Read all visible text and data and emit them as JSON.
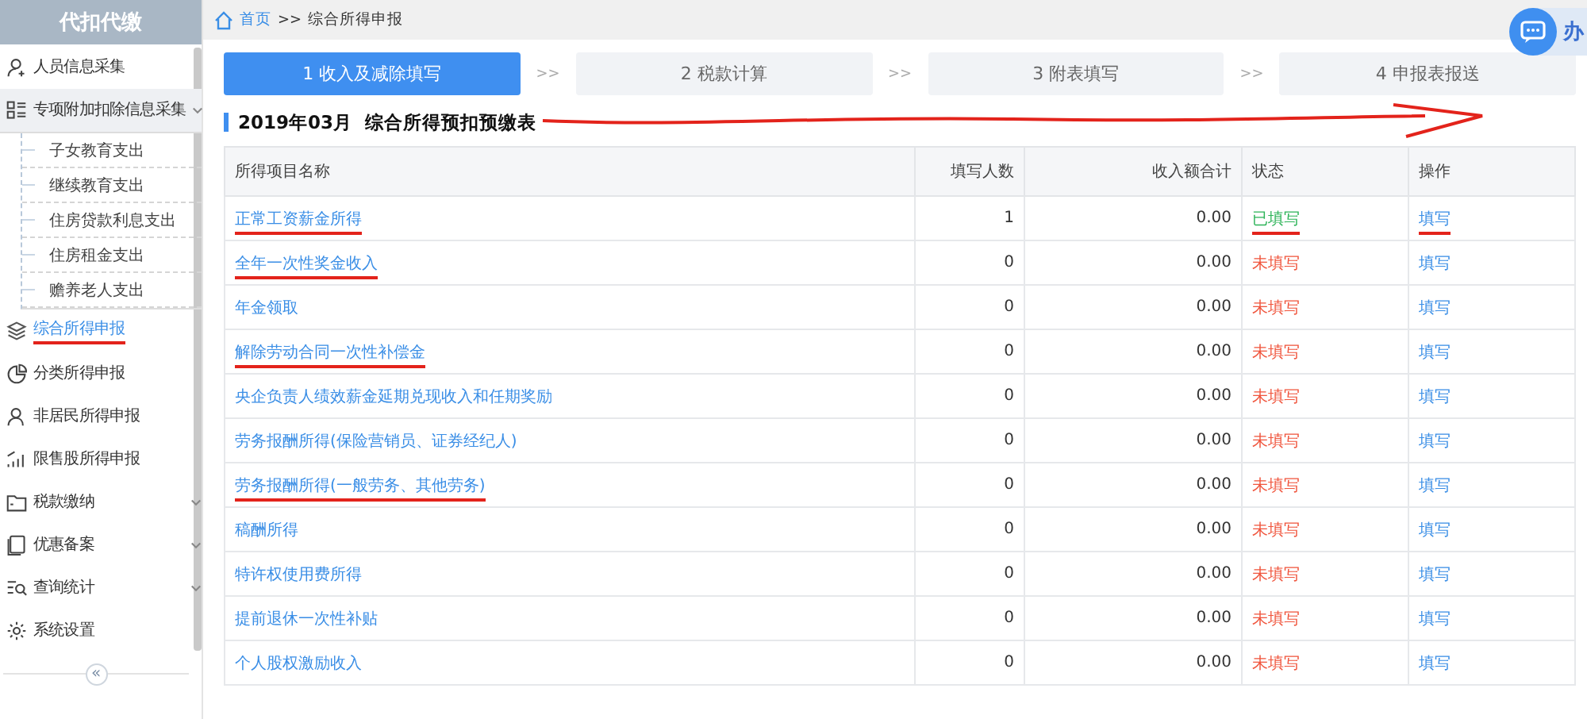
{
  "sidebar": {
    "title": "代扣代缴",
    "items": [
      {
        "label": "人员信息采集",
        "selected": false,
        "marked": false
      },
      {
        "label": "专项附加扣除信息采集",
        "selected": false,
        "marked": false,
        "expanded": true,
        "children": [
          {
            "label": "子女教育支出"
          },
          {
            "label": "继续教育支出"
          },
          {
            "label": "住房贷款利息支出"
          },
          {
            "label": "住房租金支出"
          },
          {
            "label": "赡养老人支出"
          }
        ]
      },
      {
        "label": "综合所得申报",
        "selected": true,
        "marked": true
      },
      {
        "label": "分类所得申报",
        "selected": false,
        "marked": false
      },
      {
        "label": "非居民所得申报",
        "selected": false,
        "marked": false
      },
      {
        "label": "限售股所得申报",
        "selected": false,
        "marked": false
      },
      {
        "label": "税款缴纳",
        "selected": false,
        "marked": false,
        "expanded": false
      },
      {
        "label": "优惠备案",
        "selected": false,
        "marked": false,
        "expanded": false
      },
      {
        "label": "查询统计",
        "selected": false,
        "marked": false,
        "expanded": false
      },
      {
        "label": "系统设置",
        "selected": false,
        "marked": false
      }
    ],
    "collapse_label": "«"
  },
  "breadcrumb": {
    "home": "首页",
    "separator": ">>",
    "current": "综合所得申报"
  },
  "chat_button": {
    "label": "办"
  },
  "steps": [
    {
      "label": "1 收入及减除填写",
      "selected": true
    },
    {
      "label": "2 税款计算",
      "selected": false
    },
    {
      "label": "3 附表填写",
      "selected": false
    },
    {
      "label": "4 申报表报送",
      "selected": false
    }
  ],
  "step_separators": [
    ">>",
    ">>",
    ">>"
  ],
  "title": {
    "text": "2019年03月  综合所得预扣预缴表",
    "marked": true
  },
  "table": {
    "columns": [
      "所得项目名称",
      "填写人数",
      "收入额合计",
      "状态",
      "操作"
    ],
    "rows": [
      {
        "name": "正常工资薪金所得",
        "count": "1",
        "income": "0.00",
        "status": "已填写",
        "filled": true,
        "action": "填写",
        "name_marked": true,
        "status_marked": true,
        "action_marked": true
      },
      {
        "name": "全年一次性奖金收入",
        "count": "0",
        "income": "0.00",
        "status": "未填写",
        "filled": false,
        "action": "填写",
        "name_marked": true,
        "status_marked": false,
        "action_marked": false
      },
      {
        "name": "年金领取",
        "count": "0",
        "income": "0.00",
        "status": "未填写",
        "filled": false,
        "action": "填写",
        "name_marked": false,
        "status_marked": false,
        "action_marked": false
      },
      {
        "name": "解除劳动合同一次性补偿金",
        "count": "0",
        "income": "0.00",
        "status": "未填写",
        "filled": false,
        "action": "填写",
        "name_marked": true,
        "status_marked": false,
        "action_marked": false
      },
      {
        "name": "央企负责人绩效薪金延期兑现收入和任期奖励",
        "count": "0",
        "income": "0.00",
        "status": "未填写",
        "filled": false,
        "action": "填写",
        "name_marked": false,
        "status_marked": false,
        "action_marked": false
      },
      {
        "name": "劳务报酬所得(保险营销员、证券经纪人)",
        "count": "0",
        "income": "0.00",
        "status": "未填写",
        "filled": false,
        "action": "填写",
        "name_marked": false,
        "status_marked": false,
        "action_marked": false
      },
      {
        "name": "劳务报酬所得(一般劳务、其他劳务)",
        "count": "0",
        "income": "0.00",
        "status": "未填写",
        "filled": false,
        "action": "填写",
        "name_marked": true,
        "status_marked": false,
        "action_marked": false
      },
      {
        "name": "稿酬所得",
        "count": "0",
        "income": "0.00",
        "status": "未填写",
        "filled": false,
        "action": "填写",
        "name_marked": false,
        "status_marked": false,
        "action_marked": false
      },
      {
        "name": "特许权使用费所得",
        "count": "0",
        "income": "0.00",
        "status": "未填写",
        "filled": false,
        "action": "填写",
        "name_marked": false,
        "status_marked": false,
        "action_marked": false
      },
      {
        "name": "提前退休一次性补贴",
        "count": "0",
        "income": "0.00",
        "status": "未填写",
        "filled": false,
        "action": "填写",
        "name_marked": false,
        "status_marked": false,
        "action_marked": false
      },
      {
        "name": "个人股权激励收入",
        "count": "0",
        "income": "0.00",
        "status": "未填写",
        "filled": false,
        "action": "填写",
        "name_marked": false,
        "status_marked": false,
        "action_marked": false
      }
    ]
  }
}
